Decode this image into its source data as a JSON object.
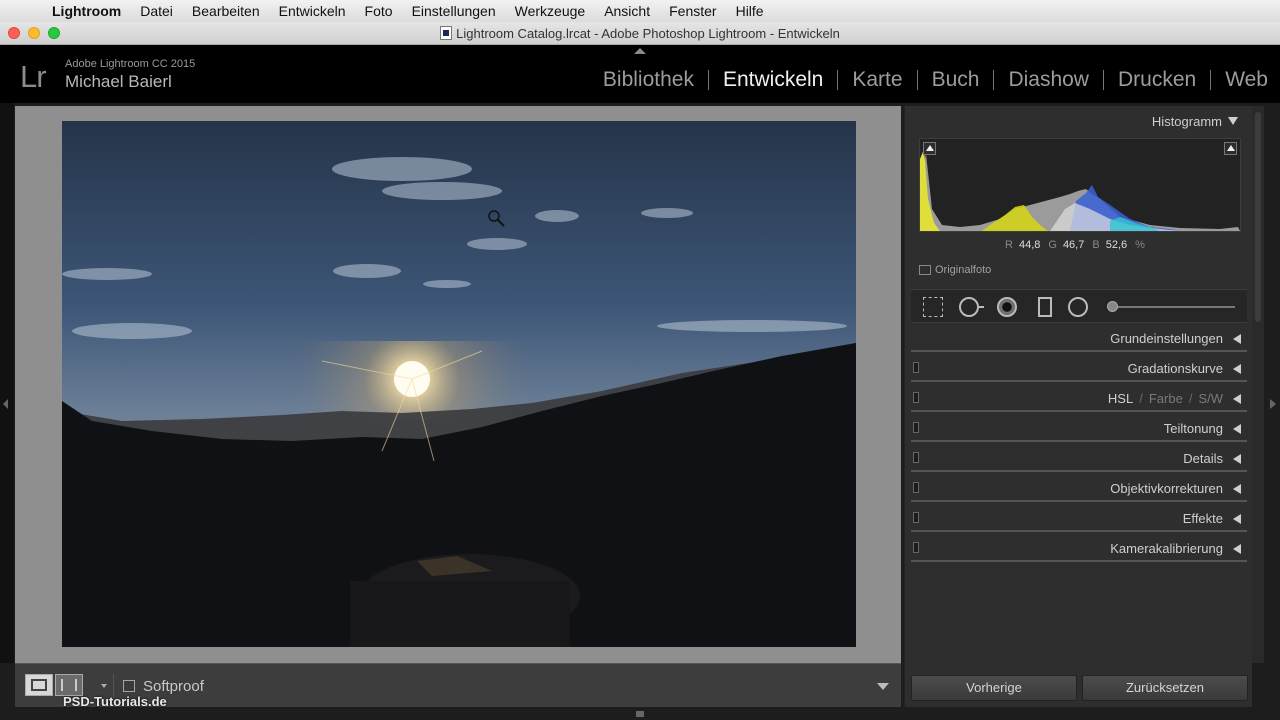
{
  "menubar": {
    "apple": "",
    "items": [
      "Lightroom",
      "Datei",
      "Bearbeiten",
      "Entwickeln",
      "Foto",
      "Einstellungen",
      "Werkzeuge",
      "Ansicht",
      "Fenster",
      "Hilfe"
    ]
  },
  "window": {
    "title": "Lightroom Catalog.lrcat - Adobe Photoshop Lightroom - Entwickeln"
  },
  "identity": {
    "logo": "Lr",
    "version": "Adobe Lightroom CC 2015",
    "user": "Michael Baierl"
  },
  "modules": [
    {
      "label": "Bibliothek"
    },
    {
      "label": "Entwickeln"
    },
    {
      "label": "Karte"
    },
    {
      "label": "Buch"
    },
    {
      "label": "Diashow"
    },
    {
      "label": "Drucken"
    },
    {
      "label": "Web"
    }
  ],
  "histogram": {
    "title": "Histogramm",
    "r_label": "R",
    "r_value": "44,8",
    "g_label": "G",
    "g_value": "46,7",
    "b_label": "B",
    "b_value": "52,6",
    "unit": "%",
    "original_label": "Originalfoto"
  },
  "sections": {
    "basic": "Grundeinstellungen",
    "tone_curve": "Gradationskurve",
    "hsl": "HSL",
    "color": "Farbe",
    "bw": "S/W",
    "separator": "/",
    "split_toning": "Teiltonung",
    "details": "Details",
    "lens": "Objektivkorrekturen",
    "effects": "Effekte",
    "calibration": "Kamerakalibrierung"
  },
  "buttons": {
    "previous": "Vorherige",
    "reset": "Zurücksetzen"
  },
  "toolbar": {
    "softproof": "Softproof"
  },
  "watermark": "PSD-Tutorials.de",
  "colors": {
    "panel_bg": "#2e2e2e",
    "canvas_bg": "#8f8f8f",
    "active_module": "#f0f0f0"
  }
}
